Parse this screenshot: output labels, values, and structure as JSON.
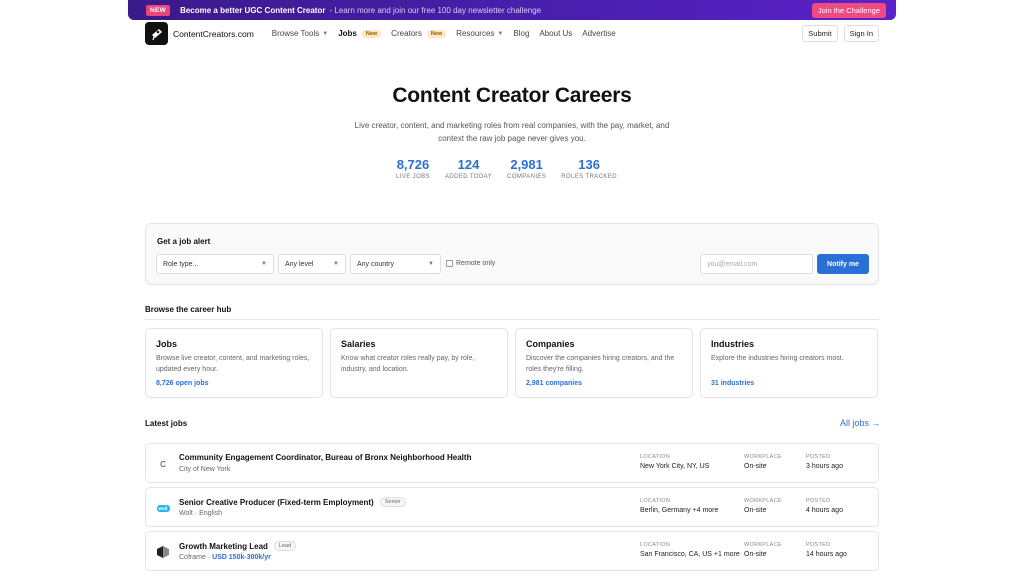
{
  "banner": {
    "badge": "NEW",
    "headline": "Become a better UGC Content Creator",
    "sub": " - Learn more and join our free 100 day newsletter challenge",
    "cta": "Join the Challenge"
  },
  "nav": {
    "brand": "ContentCreators.com",
    "items": [
      {
        "label": "Browse Tools",
        "dropdown": true
      },
      {
        "label": "Jobs",
        "tag": "New",
        "active": true
      },
      {
        "label": "Creators",
        "tag": "New"
      },
      {
        "label": "Resources",
        "dropdown": true
      },
      {
        "label": "Blog"
      },
      {
        "label": "About Us"
      },
      {
        "label": "Advertise"
      }
    ],
    "submit": "Submit",
    "signin": "Sign In"
  },
  "hero": {
    "title": "Content Creator Careers",
    "subtitle": "Live creator, content, and marketing roles from real companies, with the pay, market, and context the raw job page never gives you.",
    "stats": [
      {
        "value": "8,726",
        "label": "LIVE JOBS"
      },
      {
        "value": "124",
        "label": "ADDED TODAY"
      },
      {
        "value": "2,981",
        "label": "COMPANIES"
      },
      {
        "value": "136",
        "label": "ROLES TRACKED"
      }
    ]
  },
  "alert": {
    "title": "Get a job alert",
    "role": "Role type...",
    "level": "Any level",
    "country": "Any country",
    "remote": "Remote only",
    "email_placeholder": "you@email.com",
    "notify": "Notify me"
  },
  "hub": {
    "title": "Browse the career hub",
    "cards": [
      {
        "title": "Jobs",
        "desc": "Browse live creator, content, and marketing roles, updated every hour.",
        "link": "8,726 open jobs"
      },
      {
        "title": "Salaries",
        "desc": "Know what creator roles really pay, by role, industry, and location.",
        "link": ""
      },
      {
        "title": "Companies",
        "desc": "Discover the companies hiring creators, and the roles they're filling.",
        "link": "2,981 companies"
      },
      {
        "title": "Industries",
        "desc": "Explore the industries hiring creators most.",
        "link": "31 industries"
      }
    ]
  },
  "latest": {
    "title": "Latest jobs",
    "all": "All jobs →",
    "labels": {
      "location": "LOCATION",
      "workplace": "WORKPLACE",
      "posted": "POSTED"
    },
    "jobs": [
      {
        "title": "Community Engagement Coordinator, Bureau of Bronx Neighborhood Health",
        "company": "City of New York",
        "pay": "",
        "level": "",
        "logo": "C",
        "location": "New York City, NY, US",
        "workplace": "On-site",
        "posted": "3 hours ago"
      },
      {
        "title": "Senior Creative Producer (Fixed-term Employment)",
        "company": "Wolt · English",
        "pay": "",
        "level": "Senior",
        "logo": "wolt",
        "location": "Berlin, Germany +4 more",
        "workplace": "On-site",
        "posted": "4 hours ago"
      },
      {
        "title": "Growth Marketing Lead",
        "company": "Coframe · ",
        "pay": "USD 150k-300k/yr",
        "level": "Lead",
        "logo": "",
        "location": "San Francisco, CA, US +1 more",
        "workplace": "On-site",
        "posted": "14 hours ago"
      }
    ]
  }
}
